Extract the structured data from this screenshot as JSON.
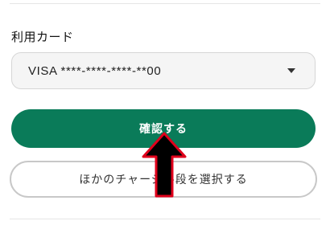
{
  "payment": {
    "card_label": "利用カード",
    "card_select_value": "VISA ****-****-****-**00"
  },
  "actions": {
    "confirm_label": "確認する",
    "other_method_label": "ほかのチャージ手段を選択する"
  },
  "colors": {
    "primary": "#0a7b59",
    "annotation_arrow_fill": "#000000",
    "annotation_arrow_stroke": "#e0001b"
  },
  "icons": {
    "select_chevron": "chevron-down-icon",
    "annotation": "arrow-up-icon"
  }
}
